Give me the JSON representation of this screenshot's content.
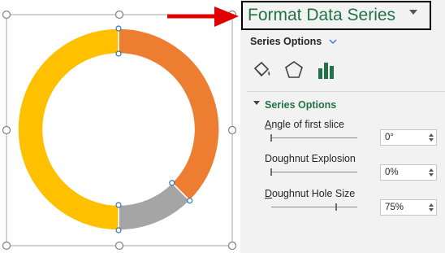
{
  "pane": {
    "title": "Format Data Series",
    "options_dropdown_label": "Series Options",
    "tabs": [
      {
        "name": "Fill & Line",
        "icon": "paint-bucket-icon"
      },
      {
        "name": "Effects",
        "icon": "pentagon-icon"
      },
      {
        "name": "Series Options",
        "icon": "bar-chart-icon",
        "active": true
      }
    ],
    "section_title": "Series Options",
    "options": [
      {
        "label": "Angle of first slice",
        "value": "0°",
        "slider_fraction": 0.0
      },
      {
        "label": "Doughnut Explosion",
        "value": "0%",
        "slider_fraction": 0.0
      },
      {
        "label": "Doughnut Hole Size",
        "value": "75%",
        "slider_fraction": 0.75
      }
    ]
  },
  "colors": {
    "series_yellow": "#FFC000",
    "series_orange": "#ED7D31",
    "series_gray": "#A5A5A5",
    "accent_green": "#217346",
    "arrow_red": "#E00000"
  },
  "chart_data": {
    "type": "pie",
    "variant": "doughnut",
    "hole_size_percent": 75,
    "slices": [
      {
        "color": "#ED7D31",
        "value": 37.5
      },
      {
        "color": "#A5A5A5",
        "value": 12.5
      },
      {
        "color": "#FFC000",
        "value": 50
      }
    ]
  }
}
